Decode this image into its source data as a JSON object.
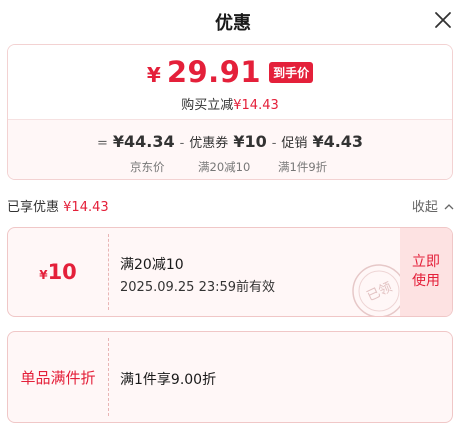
{
  "header": {
    "title": "优惠",
    "close_icon": "close-icon"
  },
  "price": {
    "currency": "¥",
    "value": "29.91",
    "tag": "到手价",
    "discount_prefix": "购买立减",
    "discount_amount": "¥14.43"
  },
  "formula": {
    "eq": "=",
    "jd_price": "¥44.34",
    "minus1": "-",
    "coupon_label": "优惠券",
    "coupon_amount": "¥10",
    "minus2": "-",
    "promo_label": "促销",
    "promo_amount": "¥4.43",
    "jd_caption": "京东价",
    "coupon_caption": "满20减10",
    "promo_caption": "满1件9折"
  },
  "enjoy": {
    "label": "已享优惠",
    "amount": "¥14.43",
    "collapse_label": "收起"
  },
  "coupon1": {
    "currency": "¥",
    "value": "10",
    "title": "满20减10",
    "expiry": "2025.09.25 23:59前有效",
    "action_line1": "立即",
    "action_line2": "使用",
    "stamp_text": "已领"
  },
  "coupon2": {
    "label": "单品满件折",
    "title": "满1件享9.00折"
  },
  "colors": {
    "accent": "#e4203a",
    "card_bg": "#fff7f7",
    "action_bg": "#fde2e2"
  }
}
